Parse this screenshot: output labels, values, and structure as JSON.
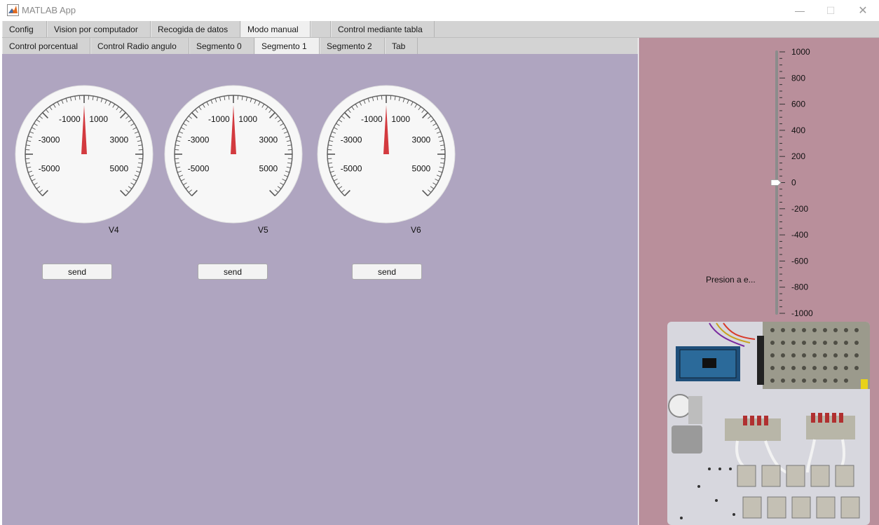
{
  "window": {
    "title": "MATLAB App",
    "minimize_glyph": "—",
    "maximize_glyph": "☐",
    "close_glyph": "✕"
  },
  "tabs_row1": [
    {
      "label": "Config"
    },
    {
      "label": "Vision por computador"
    },
    {
      "label": "Recogida de datos"
    },
    {
      "label": "Modo manual"
    },
    {
      "label": ""
    },
    {
      "label": "Control mediante tabla"
    }
  ],
  "tabs_row2": [
    {
      "label": "Control porcentual"
    },
    {
      "label": "Control Radio angulo"
    },
    {
      "label": "Segmento 0"
    },
    {
      "label": "Segmento 1"
    },
    {
      "label": "Segmento 2"
    },
    {
      "label": "Tab"
    }
  ],
  "gauges": [
    {
      "label": "V4",
      "value": 0,
      "ticks": [
        "-5000",
        "-3000",
        "-1000",
        "1000",
        "3000",
        "5000"
      ],
      "send_label": "send"
    },
    {
      "label": "V5",
      "value": 0,
      "ticks": [
        "-5000",
        "-3000",
        "-1000",
        "1000",
        "3000",
        "5000"
      ],
      "send_label": "send"
    },
    {
      "label": "V6",
      "value": 0,
      "ticks": [
        "-5000",
        "-3000",
        "-1000",
        "1000",
        "3000",
        "5000"
      ],
      "send_label": "send"
    }
  ],
  "gauge_range": {
    "min": -6000,
    "max": 6000
  },
  "slider": {
    "label": "Presion a e...",
    "value": 0,
    "min": -1000,
    "max": 1000,
    "ticks": [
      "1000",
      "800",
      "600",
      "400",
      "200",
      "0",
      "-200",
      "-400",
      "-600",
      "-800",
      "-1000"
    ]
  },
  "photo": {
    "description_icon": "pneumatic-board-photo"
  },
  "colors": {
    "left_panel": "#afa5c0",
    "right_panel": "#b98f9b",
    "needle": "#d33a3f"
  }
}
